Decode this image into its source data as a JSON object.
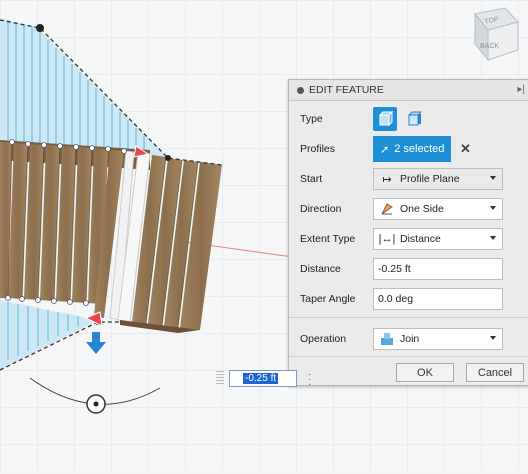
{
  "panel": {
    "title": "EDIT FEATURE",
    "rows": {
      "type_label": "Type",
      "profiles_label": "Profiles",
      "profiles_value": "2 selected",
      "start_label": "Start",
      "start_value": "Profile Plane",
      "direction_label": "Direction",
      "direction_value": "One Side",
      "extent_label": "Extent Type",
      "extent_value": "Distance",
      "distance_label": "Distance",
      "distance_value": "-0.25 ft",
      "taper_label": "Taper Angle",
      "taper_value": "0.0 deg",
      "operation_label": "Operation",
      "operation_value": "Join"
    },
    "ok_label": "OK",
    "cancel_label": "Cancel"
  },
  "viewport": {
    "distance_input": "-0.25 ft",
    "viewcube_labels": [
      "TOP",
      "BACK"
    ]
  },
  "colors": {
    "accent": "#1e8fd6",
    "sketch_fill": "#cfe9f5",
    "wood": "#9a7a58"
  }
}
